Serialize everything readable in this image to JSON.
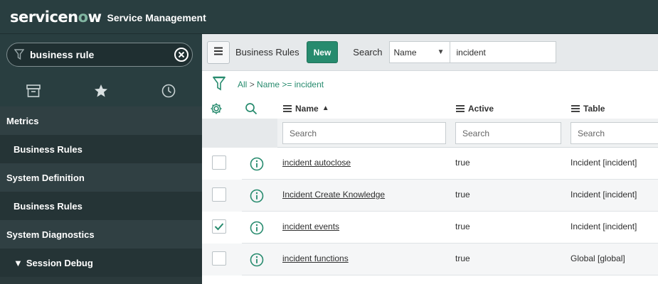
{
  "header": {
    "logo_text_a": "servicen",
    "logo_text_o": "o",
    "logo_text_b": "w",
    "product": "Service Management"
  },
  "sidebar": {
    "filter_value": "business rule",
    "tabs": [
      {
        "icon": "archive-icon"
      },
      {
        "icon": "star-icon"
      },
      {
        "icon": "history-clock-icon"
      }
    ],
    "items": [
      {
        "label": "Metrics",
        "type": "section"
      },
      {
        "label": "Business Rules",
        "type": "item"
      },
      {
        "label": "System Definition",
        "type": "section"
      },
      {
        "label": "Business Rules",
        "type": "item"
      },
      {
        "label": "System Diagnostics",
        "type": "section"
      },
      {
        "label": "Session Debug",
        "type": "item",
        "caret": "▼"
      }
    ]
  },
  "list": {
    "title": "Business Rules",
    "new_label": "New",
    "search_label": "Search",
    "search_field": "Name",
    "search_value": "incident",
    "breadcrumb_all": "All",
    "breadcrumb_sep": ">",
    "breadcrumb_cond": "Name >= incident",
    "columns": [
      {
        "label": "Name",
        "sort": "▲"
      },
      {
        "label": "Active"
      },
      {
        "label": "Table"
      }
    ],
    "search_placeholders": [
      "Search",
      "Search",
      "Search"
    ],
    "rows": [
      {
        "name": "incident autoclose",
        "active": "true",
        "table": "Incident [incident]",
        "checked": false
      },
      {
        "name": "Incident Create Knowledge",
        "active": "true",
        "table": "Incident [incident]",
        "checked": false
      },
      {
        "name": "incident events",
        "active": "true",
        "table": "Incident [incident]",
        "checked": true
      },
      {
        "name": "incident functions",
        "active": "true",
        "table": "Global [global]",
        "checked": false
      }
    ]
  },
  "colors": {
    "header_bg": "#293e40",
    "accent": "#278b6e"
  }
}
